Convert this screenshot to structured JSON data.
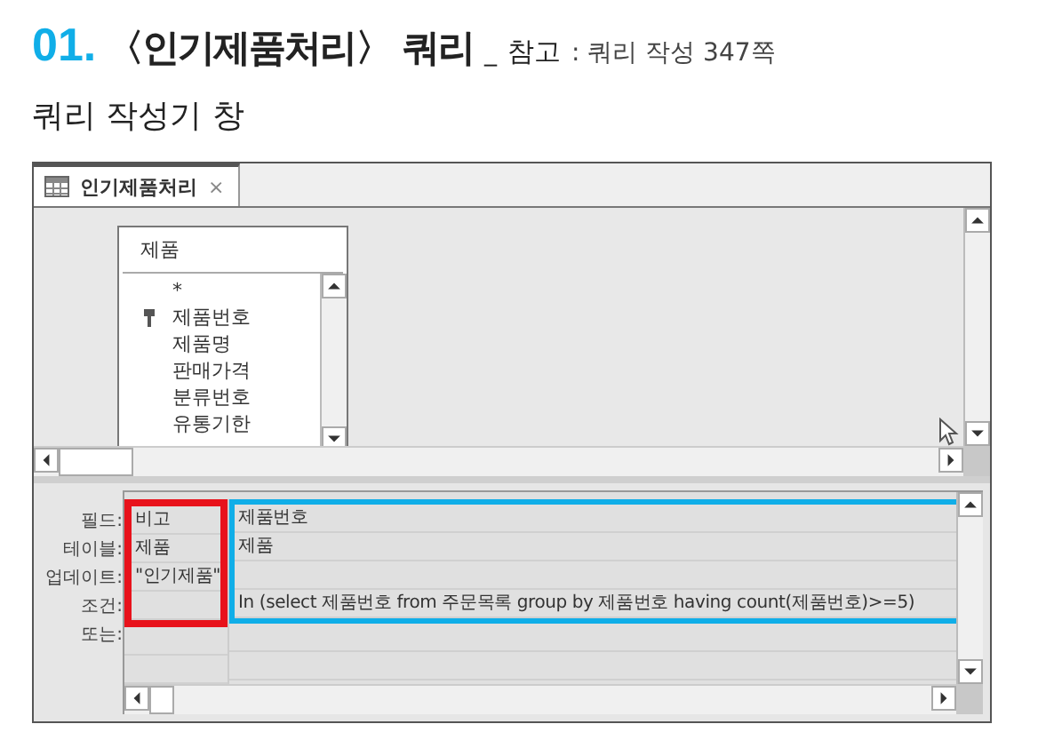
{
  "heading": {
    "number": "01.",
    "title": "〈인기제품처리〉 쿼리",
    "separator": "_",
    "note_label": "참고",
    "note_text": ": 쿼리 작성 347쪽"
  },
  "caption": "쿼리 작성기 창",
  "window": {
    "tabs": [
      {
        "label": "인기제품처리",
        "close": "×",
        "selected": true
      }
    ],
    "table_box": {
      "title": "제품",
      "fields": [
        {
          "name": "*",
          "key": false
        },
        {
          "name": "제품번호",
          "key": true
        },
        {
          "name": "제품명",
          "key": false
        },
        {
          "name": "판매가격",
          "key": false
        },
        {
          "name": "분류번호",
          "key": false
        },
        {
          "name": "유통기한",
          "key": false
        }
      ]
    },
    "grid": {
      "row_labels": [
        "필드:",
        "테이블:",
        "업데이트:",
        "조건:",
        "또는:"
      ],
      "columns": [
        {
          "cells": {
            "field": "비고",
            "table": "제품",
            "update": "\"인기제품\""
          },
          "color": "#e8121b"
        },
        {
          "cells": {
            "field": "제품번호",
            "table": "제품",
            "criteria": "In (select 제품번호 from 주문목록 group by 제품번호 having count(제품번호)>=5)"
          },
          "color": "#10aee8"
        }
      ]
    }
  }
}
